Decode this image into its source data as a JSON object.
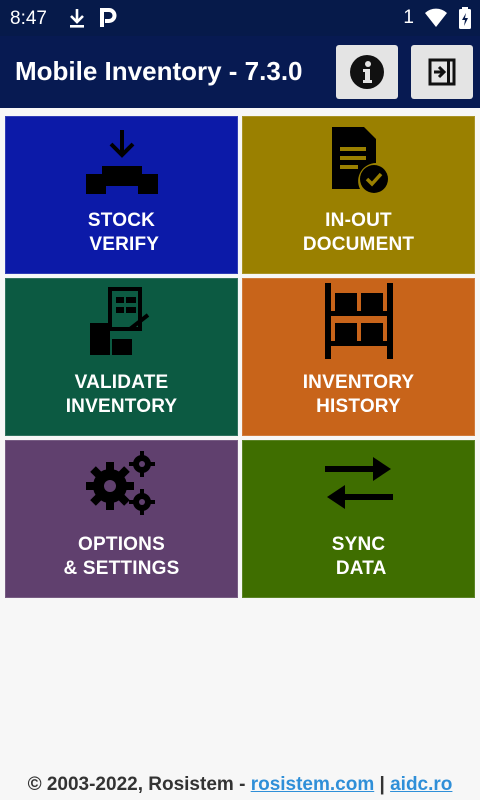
{
  "status_bar": {
    "time": "8:47",
    "notification_count": "1",
    "icons": [
      "download-icon",
      "parking-icon",
      "wifi-icon",
      "battery-icon"
    ]
  },
  "app_bar": {
    "title": "Mobile Inventory - 7.3.0",
    "info_icon": "info-icon",
    "logout_icon": "logout-icon"
  },
  "menu": {
    "tiles": [
      {
        "line1": "STOCK",
        "line2": " VERIFY",
        "color": "#0c1aa8",
        "icon": "unload-pallet-icon"
      },
      {
        "line1": "IN-OUT",
        "line2": "DOCUMENT",
        "color": "#9a8000",
        "icon": "document-check-icon"
      },
      {
        "line1": "VALIDATE",
        "line2": "INVENTORY",
        "color": "#0c5a42",
        "icon": "checklist-boxes-icon"
      },
      {
        "line1": "INVENTORY",
        "line2": "HISTORY",
        "color": "#c8641a",
        "icon": "shelf-icon"
      },
      {
        "line1": "OPTIONS",
        "line2": "& SETTINGS",
        "color": "#60406e",
        "icon": "gears-icon"
      },
      {
        "line1": "SYNC",
        "line2": " DATA",
        "color": "#3f6e00",
        "icon": "sync-arrows-icon"
      }
    ]
  },
  "footer": {
    "copyright": "© 2003-2022, Rosistem - ",
    "link1": "rosistem.com",
    "separator": " | ",
    "link2": "aidc.ro"
  }
}
